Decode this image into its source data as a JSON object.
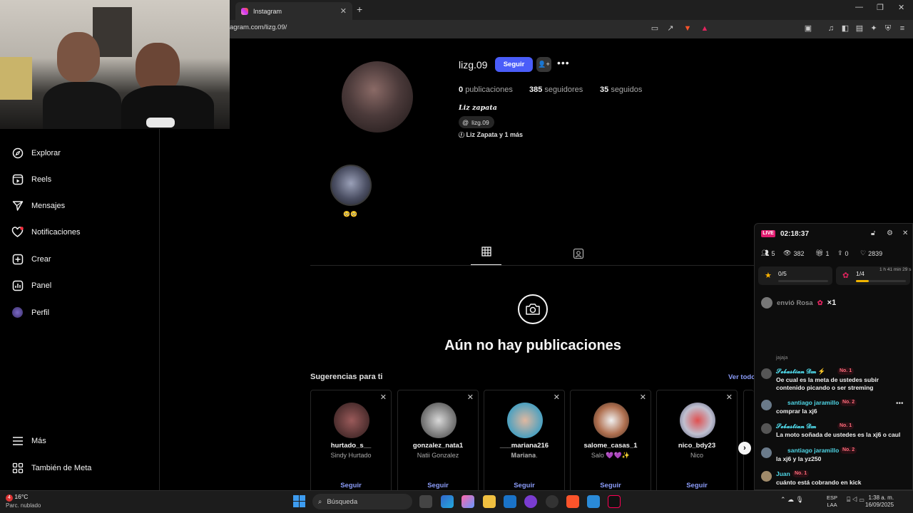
{
  "browser": {
    "tab_title": "Instagram",
    "url": "agram.com/lizg.09/",
    "new_tab": "+",
    "close": "✕"
  },
  "profile": {
    "username": "lizg.09",
    "follow_label": "Seguir",
    "more_label": "•••",
    "posts_count": "0",
    "posts_label": "publicaciones",
    "followers_count": "385",
    "followers_label": "seguidores",
    "following_count": "35",
    "following_label": "seguidos",
    "full_name": "Liz zapata",
    "threads_handle": "lizg.09",
    "meta_link": "Liz Zapata y 1 más",
    "highlight_label": "🥺🥺"
  },
  "empty_state": {
    "title": "Aún no hay publicaciones"
  },
  "sidebar": {
    "items": [
      {
        "label": "Explorar",
        "icon": "compass-icon"
      },
      {
        "label": "Reels",
        "icon": "reels-icon"
      },
      {
        "label": "Mensajes",
        "icon": "send-icon"
      },
      {
        "label": "Notificaciones",
        "icon": "heart-icon"
      },
      {
        "label": "Crear",
        "icon": "plus-square-icon"
      },
      {
        "label": "Panel",
        "icon": "chart-icon"
      },
      {
        "label": "Perfil",
        "icon": "avatar-icon"
      }
    ],
    "more_label": "Más",
    "meta_label": "También de Meta"
  },
  "suggestions": {
    "title": "Sugerencias para ti",
    "see_all": "Ver todo",
    "cards": [
      {
        "username": "hurtado_s__",
        "name": "Sindy Hurtado",
        "follow": "Seguir",
        "color": "#6a3a3a"
      },
      {
        "username": "gonzalez_nata1",
        "name": "Natii Gonzalez",
        "follow": "Seguir",
        "color": "#555555"
      },
      {
        "username": "___mariana216",
        "name": "𝐌𝐚𝐫𝐢𝐚𝐧𝐚.",
        "follow": "Seguir",
        "color": "#2f6d86"
      },
      {
        "username": "salome_casas_1",
        "name": "Salo 💜💜✨",
        "follow": "Seguir",
        "color": "#8a6a5a"
      },
      {
        "username": "nico_bdy23",
        "name": "Nico",
        "follow": "Seguir",
        "color": "#7a3c52"
      }
    ]
  },
  "live": {
    "badge": "LIVE",
    "time": "02:18:37",
    "stats": {
      "guests": "5",
      "viewers": "382",
      "gifts": "1",
      "shares": "0",
      "likes": "2839"
    },
    "goal1": {
      "value": "0/5",
      "progress": 0
    },
    "goal2": {
      "value": "1/4",
      "progress": 0.25,
      "timer": "1 h 41 min 29 s"
    },
    "gift_text": "envió Rosa",
    "gift_mult": "×1",
    "chat_cut": "jajaja",
    "messages": [
      {
        "name": "𝓢𝓮𝓫𝓪𝓼𝓽𝓲𝓪𝓷 𝓓𝓶 ⚡",
        "rank": "No. 1",
        "text": "Oe cual es la meta de ustedes subir contenido picando o ser streming",
        "name_color": "#4fd6e6"
      },
      {
        "name": "santiago jaramillo",
        "rank": "No. 2",
        "text": "comprar la xj6",
        "name_color": "#4fd6e6"
      },
      {
        "name": "𝓢𝓮𝓫𝓪𝓼𝓽𝓲𝓪𝓷 𝓓𝓶",
        "rank": "No. 1",
        "text": "La moto soñada de ustedes es la xj6 o caul",
        "name_color": "#4fd6e6"
      },
      {
        "name": "santiago jaramillo",
        "rank": "No. 2",
        "text": "la xj6 y la yz250",
        "name_color": "#4fd6e6"
      },
      {
        "name": "Juan",
        "rank": "No. 1",
        "text": "cuánto está cobrando en kick",
        "name_color": "#4fd6e6"
      }
    ]
  },
  "taskbar": {
    "temp": "16°C",
    "weather": "Parc. nublado",
    "weather_badge": "4",
    "search": "Búsqueda",
    "lang_top": "ESP",
    "lang_bottom": "LAA",
    "time": "1:38 a. m.",
    "date": "16/09/2025"
  },
  "colors": {
    "accent": "#4a5df9",
    "live": "#e01b6f",
    "link": "#8b9cf9"
  }
}
